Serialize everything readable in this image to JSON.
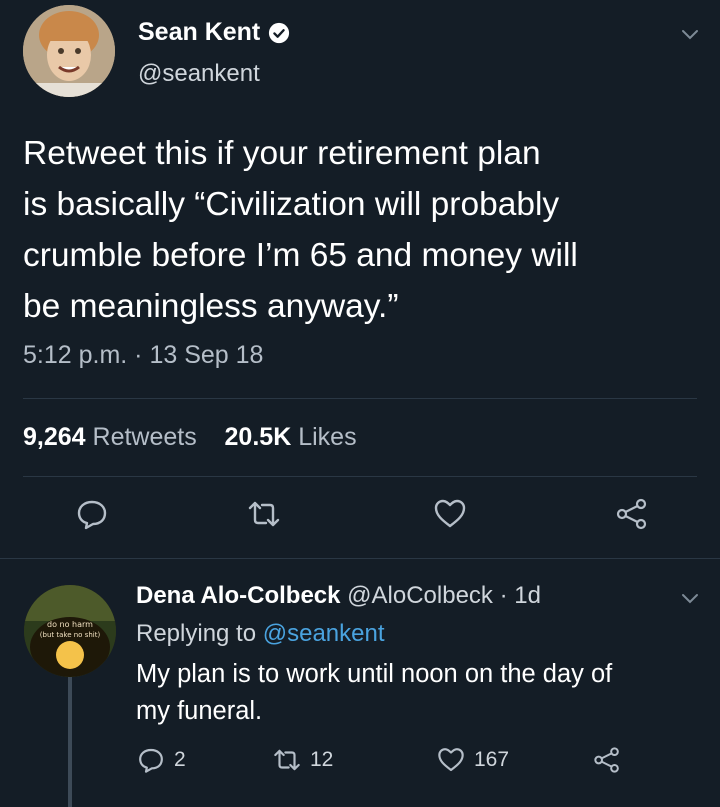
{
  "tweet": {
    "author_name": "Sean Kent",
    "author_handle": "@seankent",
    "text_lines": [
      "Retweet this if your retirement plan",
      "is basically “Civilization will probably",
      "crumble before I’m 65 and money will",
      "be meaningless anyway.”"
    ],
    "timestamp": "5:12 p.m. · 13 Sep 18",
    "retweet_count": "9,264",
    "retweet_label": "Retweets",
    "like_count": "20.5K",
    "like_label": "Likes"
  },
  "reply": {
    "author_name": "Dena Alo-Colbeck",
    "author_handle": "@AloColbeck",
    "age": "· 1d",
    "replying_prefix": "Replying to",
    "replying_handle": "@seankent",
    "text_lines": [
      "My plan is to work until noon on the day of",
      "my funeral."
    ],
    "reply_count": "2",
    "retweet_count": "12",
    "like_count": "167",
    "avatar_text": [
      "do no harm",
      "(but take no shit)"
    ]
  },
  "colors": {
    "background": "#141d26",
    "link": "#4aa3df",
    "muted": "#b5bec8",
    "divider": "#2a3744"
  },
  "icons": [
    "verified-icon",
    "chevron-down-icon",
    "reply-icon",
    "retweet-icon",
    "like-icon",
    "share-icon"
  ]
}
